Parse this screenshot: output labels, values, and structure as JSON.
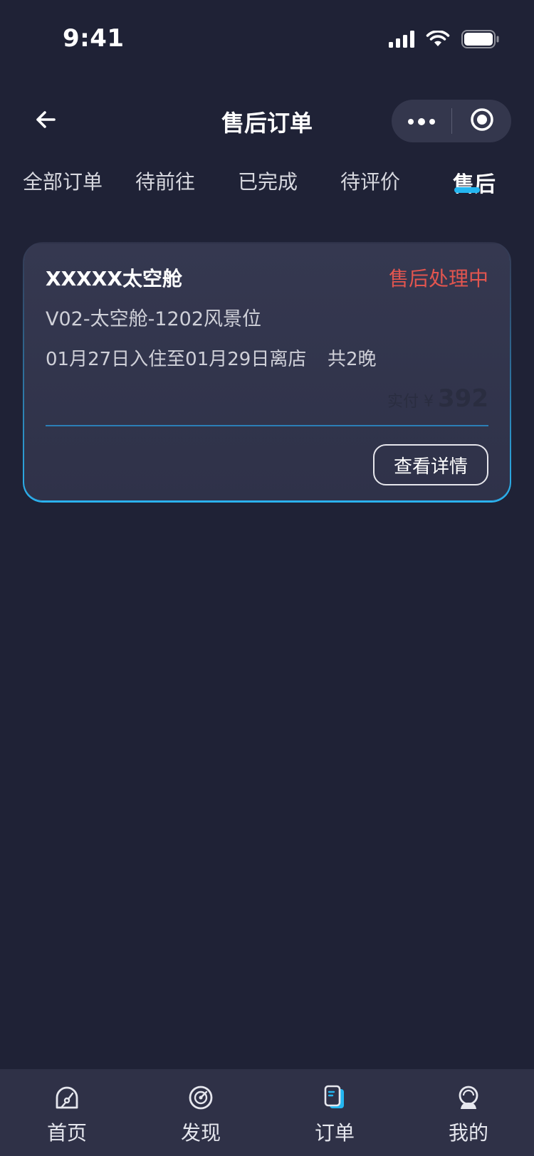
{
  "status_bar": {
    "time": "9:41"
  },
  "nav": {
    "title": "售后订单"
  },
  "tabs": [
    {
      "label": "全部订单",
      "active": false
    },
    {
      "label": "待前往",
      "active": false
    },
    {
      "label": "已完成",
      "active": false
    },
    {
      "label": "待评价",
      "active": false
    },
    {
      "label": "售后",
      "active": true
    }
  ],
  "order": {
    "shop_name": "XXXXX太空舱",
    "status": "售后处理中",
    "room": "V02-太空舱-1202风景位",
    "dates": "01月27日入住至01月29日离店",
    "nights": "共2晚",
    "price_label": "实付 ¥",
    "price": "392",
    "detail_button": "查看详情"
  },
  "tabbar": [
    {
      "label": "首页",
      "icon": "home-dashboard-icon"
    },
    {
      "label": "发现",
      "icon": "discover-radar-icon"
    },
    {
      "label": "订单",
      "icon": "order-document-icon",
      "active": true
    },
    {
      "label": "我的",
      "icon": "profile-astronaut-icon"
    }
  ],
  "colors": {
    "background": "#1f2236",
    "card": "#353850",
    "accent": "#24b6f0",
    "status_red": "#e2554f"
  }
}
